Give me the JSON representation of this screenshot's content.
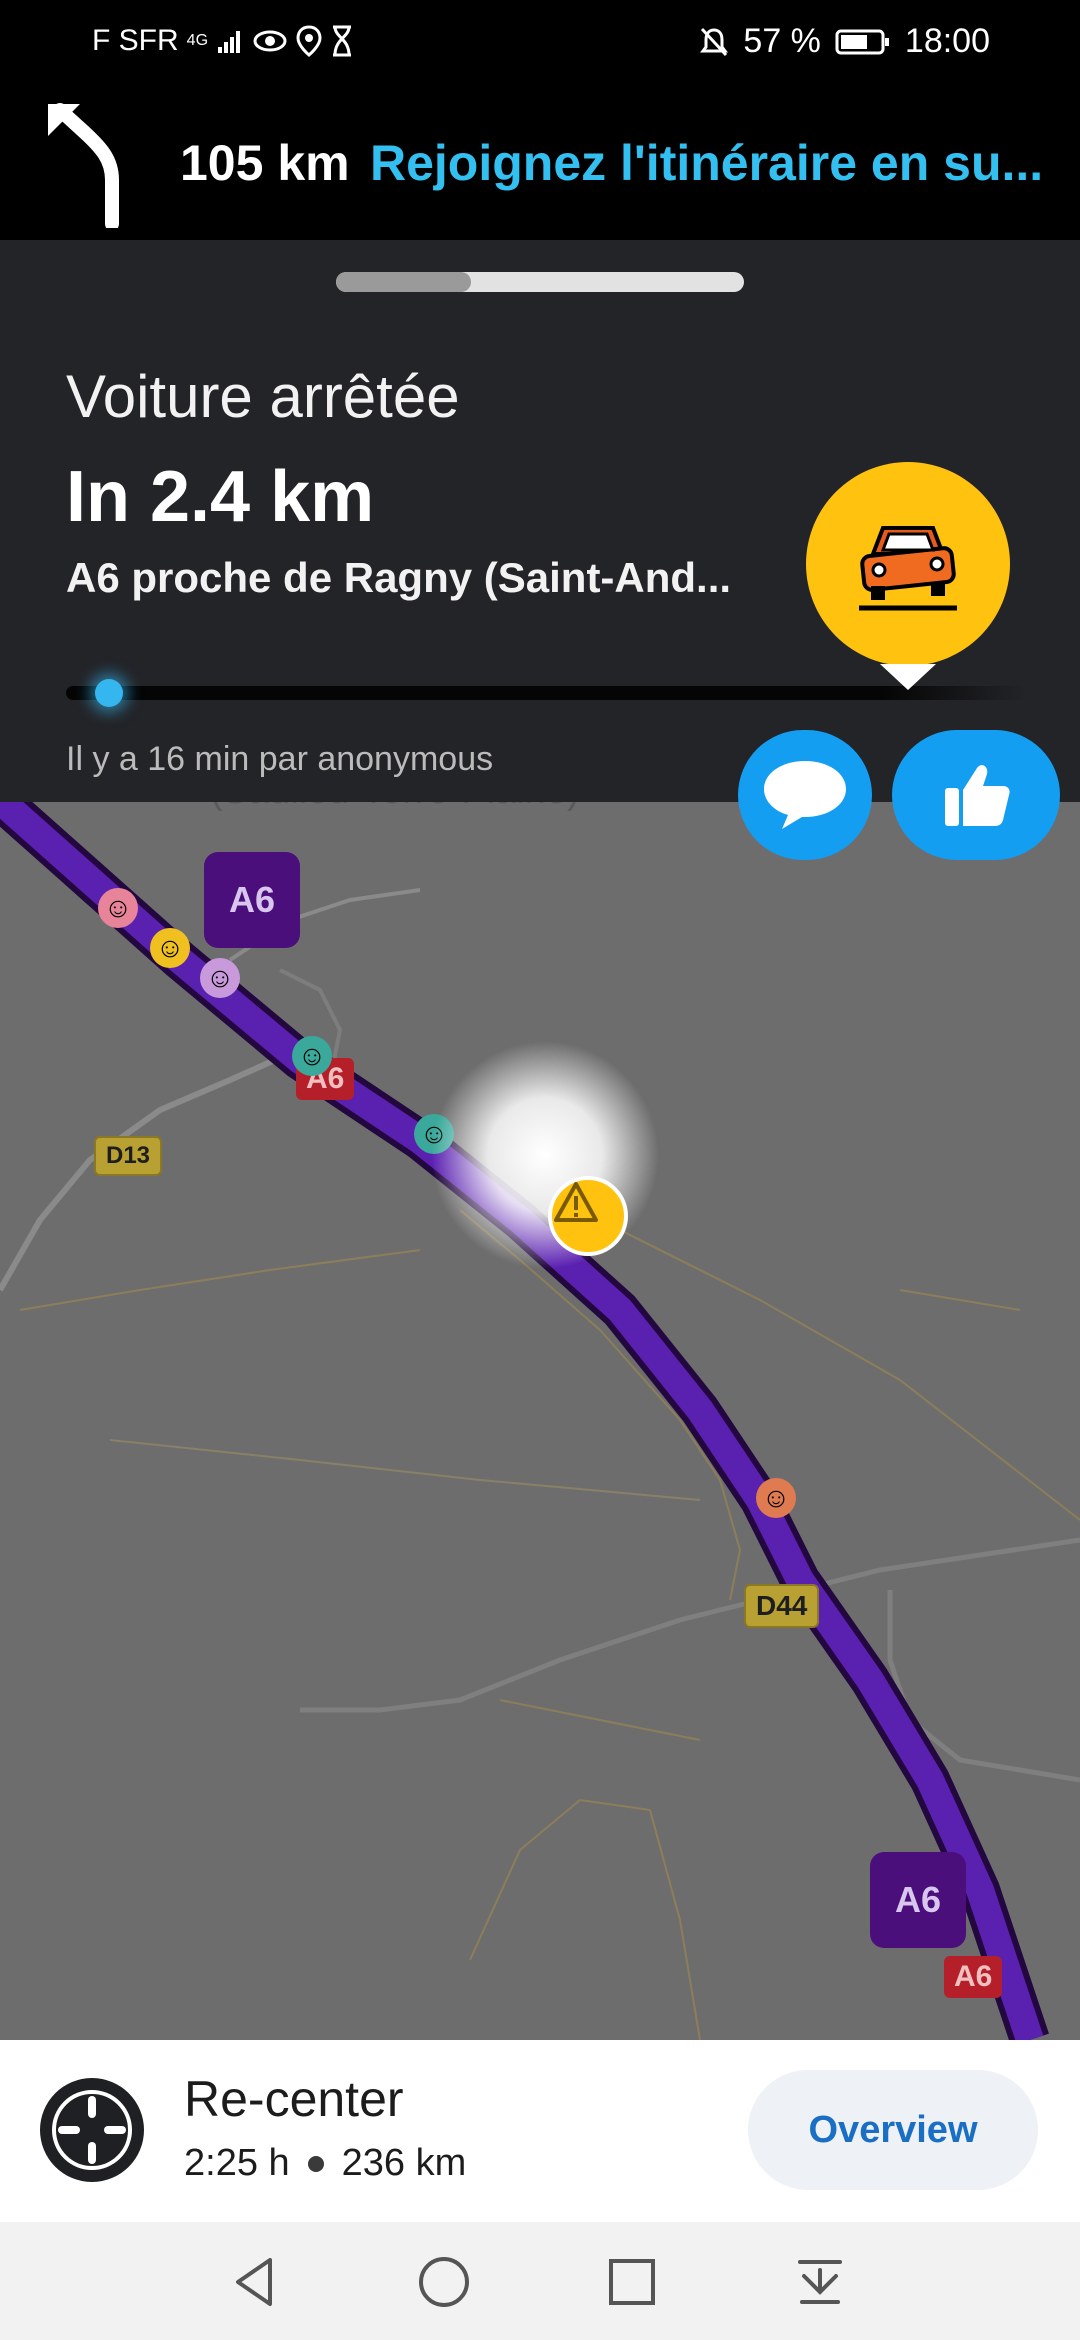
{
  "status_bar": {
    "carrier": "F SFR",
    "network": "4G",
    "battery": "57 %",
    "time": "18:00"
  },
  "navigation": {
    "distance": "105 km",
    "instruction": "Rejoignez l'itinéraire en su..."
  },
  "alert": {
    "type": "Voiture arrêtée",
    "distance": "In 2.4 km",
    "location": "A6 proche de Ragny (Saint-And...",
    "meta": "Il y a 16 min par anonymous",
    "progress_fraction": 0.03,
    "handle_fraction": 0.33,
    "icon_color": "#ffc20e"
  },
  "map": {
    "faint_label": "(Saulieu-Terre-Plaine)",
    "shields": {
      "a6_purple_top": "A6",
      "a6_red_mid": "A6",
      "d13": "D13",
      "d44": "D44",
      "a6_purple_bottom": "A6",
      "a6_red_bottom": "A6"
    },
    "route_color": "#4a1490"
  },
  "bottom_bar": {
    "recenter_label": "Re-center",
    "eta": "2:25 h",
    "remaining_distance": "236 km",
    "overview_label": "Overview"
  }
}
